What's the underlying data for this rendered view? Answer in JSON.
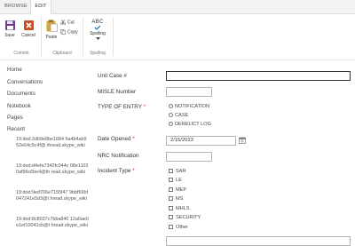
{
  "tabs": {
    "browse": "BROWSE",
    "edit": "EDIT"
  },
  "ribbon": {
    "save": "Save",
    "cancel": "Cancel",
    "paste": "Paste",
    "cut": "Cut",
    "copy": "Copy",
    "abc": "ABC",
    "spelling": "Spelling",
    "group_commit": "Commit",
    "group_clipboard": "Clipboard",
    "group_spelling": "Spelling"
  },
  "nav": {
    "items": [
      "Home",
      "Conversations",
      "Documents",
      "Notebook",
      "Pages",
      "Recent"
    ],
    "recent": [
      "19:dod:2db9e8be1684 6a4b4ab952e64c5c4f@ thread.skype_wiki",
      "19:dod:d4efa7342fc044c 08e11030af96c6be4@th read.skype_wiki",
      "19:dod:9ed706e7155f47 9bbf69bf047241e5d3@t hread.skype_wiki",
      "19:dod:8c8037c7bba840 12a0ae0e1ef10041cb@t hread.skype_wiki"
    ]
  },
  "form": {
    "unit_case_label": "Unit Case #",
    "unit_case_value": "",
    "msile_label": "MISLE Number",
    "msile_value": "",
    "type_label": "TYPE OF ENTRY",
    "type_options": [
      "NOTIFICATION",
      "CASE",
      "DERELICT LOG"
    ],
    "date_label": "Date Opened",
    "date_value": "2/15/2023",
    "nrc_label": "NRC Notification",
    "nrc_value": "",
    "incident_label": "Incident Type",
    "incident_options": [
      "SAR",
      "LE",
      "MEP",
      "MS",
      "MHLS",
      "SECURITY",
      "Other"
    ],
    "required_mark": "*"
  },
  "colors": {
    "save": "#6b3f8c",
    "cancel": "#d04a20",
    "paste": "#d9a63a"
  }
}
